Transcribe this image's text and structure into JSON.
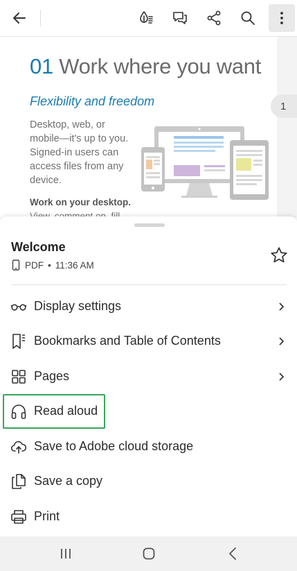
{
  "toolbar": {
    "back_icon": "arrow-left-icon",
    "icons": [
      "liquid-mode-icon",
      "comment-icon",
      "share-icon",
      "search-icon",
      "more-vertical-icon"
    ]
  },
  "document": {
    "heading_number": "01",
    "heading_text": "Work where you want",
    "subheading": "Flexibility and freedom",
    "body_lines": [
      "Desktop, web, or",
      "mobile—it's up to you.",
      "Signed-in users can",
      "access files from any",
      "device."
    ],
    "bold_line": "Work on your desktop.",
    "cut_line": "View, comment on, fill",
    "page_number": "1"
  },
  "sheet": {
    "title": "Welcome",
    "file_type": "PDF",
    "separator": "•",
    "time": "11:36 AM",
    "menu": [
      {
        "label": "Display settings",
        "icon": "glasses-icon",
        "chevron": true
      },
      {
        "label": "Bookmarks and Table of Contents",
        "icon": "bookmark-list-icon",
        "chevron": true
      },
      {
        "label": "Pages",
        "icon": "grid-icon",
        "chevron": true
      },
      {
        "label": "Read aloud",
        "icon": "headphones-icon",
        "chevron": false
      },
      {
        "label": "Save to Adobe cloud storage",
        "icon": "cloud-upload-icon",
        "chevron": false
      },
      {
        "label": "Save a copy",
        "icon": "copy-icon",
        "chevron": false
      },
      {
        "label": "Print",
        "icon": "printer-icon",
        "chevron": false
      }
    ]
  },
  "colors": {
    "accent_blue": "#1a7bb0",
    "highlight_green": "#3aa55a"
  },
  "navbar": {
    "icons": [
      "recent-apps-icon",
      "home-icon",
      "back-icon"
    ]
  }
}
